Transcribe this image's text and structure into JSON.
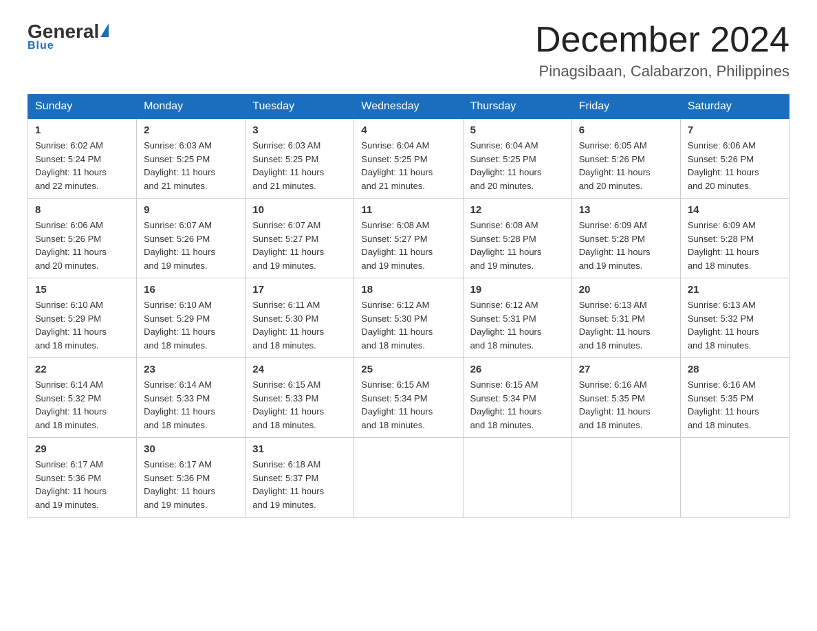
{
  "header": {
    "logo": {
      "general": "General",
      "blue": "Blue",
      "underline": "Blue"
    },
    "title": "December 2024",
    "subtitle": "Pinagsibaan, Calabarzon, Philippines"
  },
  "days_of_week": [
    "Sunday",
    "Monday",
    "Tuesday",
    "Wednesday",
    "Thursday",
    "Friday",
    "Saturday"
  ],
  "weeks": [
    [
      {
        "day": "1",
        "sunrise": "6:02 AM",
        "sunset": "5:24 PM",
        "daylight": "11 hours and 22 minutes."
      },
      {
        "day": "2",
        "sunrise": "6:03 AM",
        "sunset": "5:25 PM",
        "daylight": "11 hours and 21 minutes."
      },
      {
        "day": "3",
        "sunrise": "6:03 AM",
        "sunset": "5:25 PM",
        "daylight": "11 hours and 21 minutes."
      },
      {
        "day": "4",
        "sunrise": "6:04 AM",
        "sunset": "5:25 PM",
        "daylight": "11 hours and 21 minutes."
      },
      {
        "day": "5",
        "sunrise": "6:04 AM",
        "sunset": "5:25 PM",
        "daylight": "11 hours and 20 minutes."
      },
      {
        "day": "6",
        "sunrise": "6:05 AM",
        "sunset": "5:26 PM",
        "daylight": "11 hours and 20 minutes."
      },
      {
        "day": "7",
        "sunrise": "6:06 AM",
        "sunset": "5:26 PM",
        "daylight": "11 hours and 20 minutes."
      }
    ],
    [
      {
        "day": "8",
        "sunrise": "6:06 AM",
        "sunset": "5:26 PM",
        "daylight": "11 hours and 20 minutes."
      },
      {
        "day": "9",
        "sunrise": "6:07 AM",
        "sunset": "5:26 PM",
        "daylight": "11 hours and 19 minutes."
      },
      {
        "day": "10",
        "sunrise": "6:07 AM",
        "sunset": "5:27 PM",
        "daylight": "11 hours and 19 minutes."
      },
      {
        "day": "11",
        "sunrise": "6:08 AM",
        "sunset": "5:27 PM",
        "daylight": "11 hours and 19 minutes."
      },
      {
        "day": "12",
        "sunrise": "6:08 AM",
        "sunset": "5:28 PM",
        "daylight": "11 hours and 19 minutes."
      },
      {
        "day": "13",
        "sunrise": "6:09 AM",
        "sunset": "5:28 PM",
        "daylight": "11 hours and 19 minutes."
      },
      {
        "day": "14",
        "sunrise": "6:09 AM",
        "sunset": "5:28 PM",
        "daylight": "11 hours and 18 minutes."
      }
    ],
    [
      {
        "day": "15",
        "sunrise": "6:10 AM",
        "sunset": "5:29 PM",
        "daylight": "11 hours and 18 minutes."
      },
      {
        "day": "16",
        "sunrise": "6:10 AM",
        "sunset": "5:29 PM",
        "daylight": "11 hours and 18 minutes."
      },
      {
        "day": "17",
        "sunrise": "6:11 AM",
        "sunset": "5:30 PM",
        "daylight": "11 hours and 18 minutes."
      },
      {
        "day": "18",
        "sunrise": "6:12 AM",
        "sunset": "5:30 PM",
        "daylight": "11 hours and 18 minutes."
      },
      {
        "day": "19",
        "sunrise": "6:12 AM",
        "sunset": "5:31 PM",
        "daylight": "11 hours and 18 minutes."
      },
      {
        "day": "20",
        "sunrise": "6:13 AM",
        "sunset": "5:31 PM",
        "daylight": "11 hours and 18 minutes."
      },
      {
        "day": "21",
        "sunrise": "6:13 AM",
        "sunset": "5:32 PM",
        "daylight": "11 hours and 18 minutes."
      }
    ],
    [
      {
        "day": "22",
        "sunrise": "6:14 AM",
        "sunset": "5:32 PM",
        "daylight": "11 hours and 18 minutes."
      },
      {
        "day": "23",
        "sunrise": "6:14 AM",
        "sunset": "5:33 PM",
        "daylight": "11 hours and 18 minutes."
      },
      {
        "day": "24",
        "sunrise": "6:15 AM",
        "sunset": "5:33 PM",
        "daylight": "11 hours and 18 minutes."
      },
      {
        "day": "25",
        "sunrise": "6:15 AM",
        "sunset": "5:34 PM",
        "daylight": "11 hours and 18 minutes."
      },
      {
        "day": "26",
        "sunrise": "6:15 AM",
        "sunset": "5:34 PM",
        "daylight": "11 hours and 18 minutes."
      },
      {
        "day": "27",
        "sunrise": "6:16 AM",
        "sunset": "5:35 PM",
        "daylight": "11 hours and 18 minutes."
      },
      {
        "day": "28",
        "sunrise": "6:16 AM",
        "sunset": "5:35 PM",
        "daylight": "11 hours and 18 minutes."
      }
    ],
    [
      {
        "day": "29",
        "sunrise": "6:17 AM",
        "sunset": "5:36 PM",
        "daylight": "11 hours and 19 minutes."
      },
      {
        "day": "30",
        "sunrise": "6:17 AM",
        "sunset": "5:36 PM",
        "daylight": "11 hours and 19 minutes."
      },
      {
        "day": "31",
        "sunrise": "6:18 AM",
        "sunset": "5:37 PM",
        "daylight": "11 hours and 19 minutes."
      },
      null,
      null,
      null,
      null
    ]
  ],
  "labels": {
    "sunrise": "Sunrise:",
    "sunset": "Sunset:",
    "daylight": "Daylight:"
  }
}
